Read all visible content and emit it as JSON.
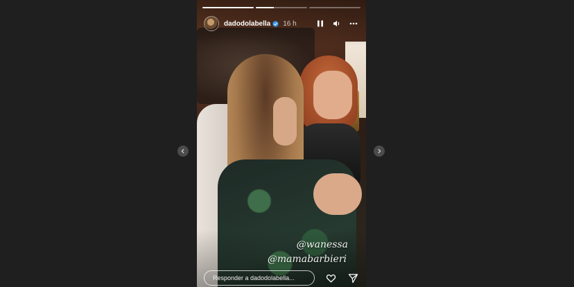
{
  "story": {
    "username": "dadodolabella",
    "timestamp": "16 h",
    "progress": [
      1.0,
      0.35,
      0.0
    ],
    "mentions": [
      "@wanessa",
      "@mamabarbieri"
    ],
    "reply_placeholder": "Responder a dadodolabella..."
  },
  "icons": {
    "prev": "chevron-left-icon",
    "next": "chevron-right-icon",
    "verified": "verified-badge-icon",
    "pause": "pause-icon",
    "volume": "volume-icon",
    "more": "more-options-icon",
    "like": "heart-icon",
    "share": "send-icon"
  },
  "colors": {
    "page_bg": "#1f1f1f",
    "nav_btn": "#4b4b4b",
    "verified": "#3897f0"
  }
}
